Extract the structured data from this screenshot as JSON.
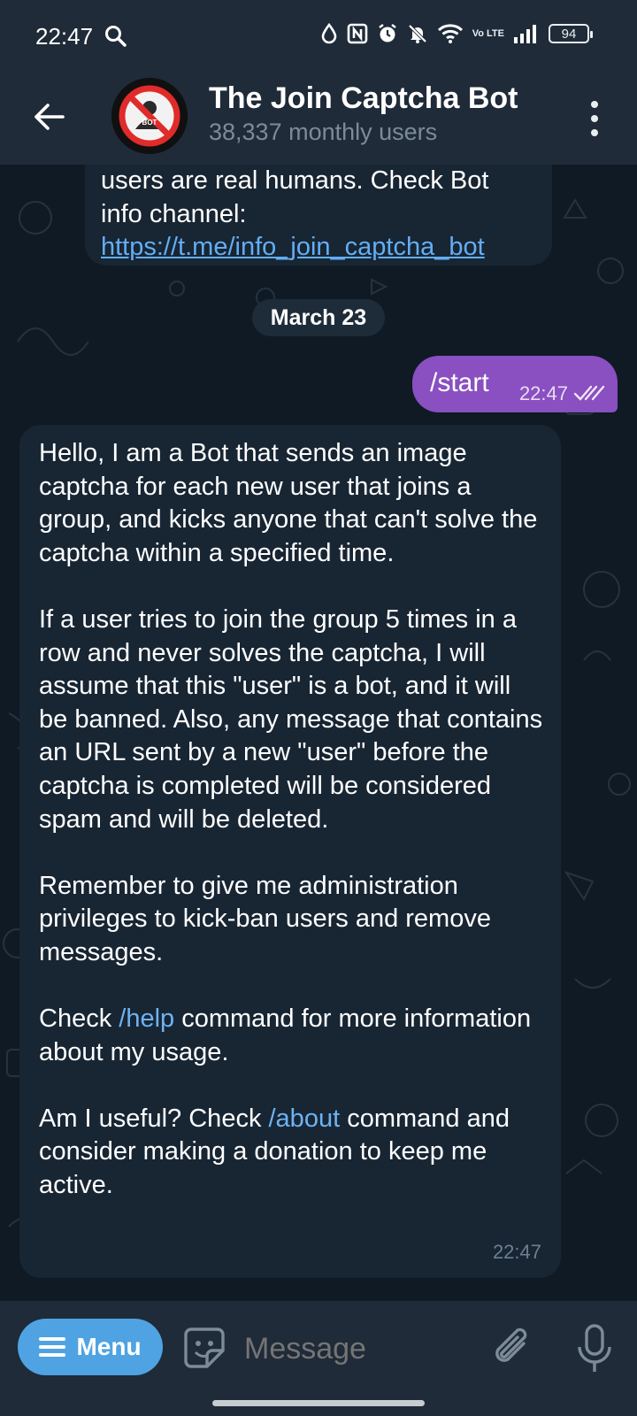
{
  "status_bar": {
    "time": "22:47",
    "battery": "94",
    "volte": "Vo LTE",
    "icons": [
      "search-icon",
      "water-drop-icon",
      "nfc-icon",
      "alarm-icon",
      "mute-bell-icon",
      "wifi-icon",
      "signal-icon",
      "battery-icon"
    ]
  },
  "header": {
    "title": "The Join Captcha Bot",
    "subtitle": "38,337 monthly users",
    "avatar_text": "BOT"
  },
  "chat": {
    "previous_message": {
      "line1": "users are real humans. Check Bot",
      "line2": "info channel:",
      "link": "https://t.me/info_join_captcha_bot"
    },
    "date_separator": "March 23",
    "outgoing": {
      "text": "/start",
      "time": "22:47"
    },
    "incoming": {
      "p1": "Hello, I am a Bot that sends an image captcha for each new user that joins a group, and kicks anyone that can't solve the captcha within a specified time.",
      "p2": "If a user tries to join the group 5 times in a row and never solves the captcha, I will assume that this \"user\" is a bot, and it will be banned. Also, any message that contains an URL sent by a new \"user\" before the captcha is completed will be considered spam and will be deleted.",
      "p3": "Remember to give me administration privileges to kick-ban users and remove messages.",
      "p4_before": "Check ",
      "p4_cmd": "/help",
      "p4_after": " command for more information about my usage.",
      "p5_before": "Am I useful? Check ",
      "p5_cmd": "/about",
      "p5_after": " command and consider making a donation to keep me active.",
      "time": "22:47"
    }
  },
  "input_bar": {
    "menu_label": "Menu",
    "placeholder": "Message"
  },
  "colors": {
    "header_bg": "#1f2b38",
    "chat_bg": "#0f1a24",
    "incoming_bubble": "#182533",
    "outgoing_bubble": "#8a4fc0",
    "link": "#62aef5",
    "menu_button": "#4fa3e3"
  }
}
